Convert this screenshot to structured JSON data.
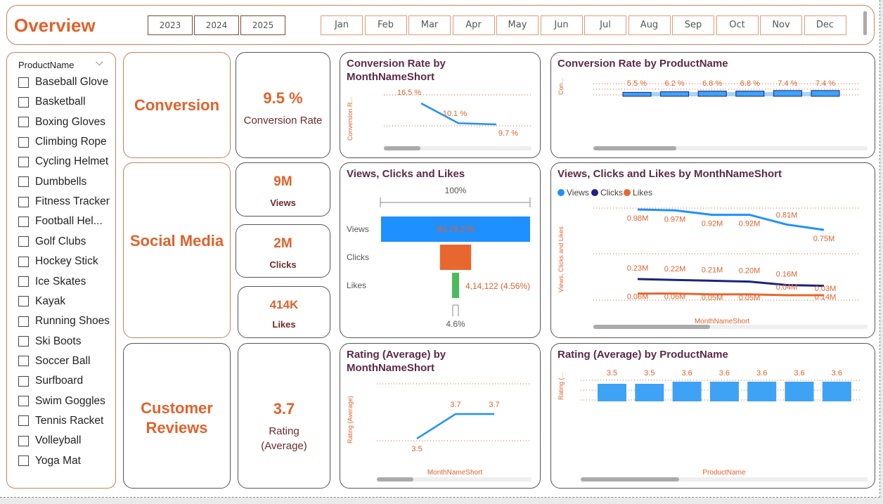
{
  "header": {
    "title": "Overview",
    "years": [
      "2023",
      "2024",
      "2025"
    ],
    "months": [
      "Jan",
      "Feb",
      "Mar",
      "Apr",
      "May",
      "Jun",
      "Jul",
      "Aug",
      "Sep",
      "Oct",
      "Nov",
      "Dec"
    ]
  },
  "slicer": {
    "title": "ProductName",
    "items": [
      "Baseball Glove",
      "Basketball",
      "Boxing Gloves",
      "Climbing Rope",
      "Cycling Helmet",
      "Dumbbells",
      "Fitness Tracker",
      "Football Hel...",
      "Golf Clubs",
      "Hockey Stick",
      "Ice Skates",
      "Kayak",
      "Running Shoes",
      "Ski Boots",
      "Soccer Ball",
      "Surfboard",
      "Swim Goggles",
      "Tennis Racket",
      "Volleyball",
      "Yoga Mat"
    ]
  },
  "sections": {
    "conversion": "Conversion",
    "social": "Social Media",
    "reviews_line1": "Customer",
    "reviews_line2": "Reviews"
  },
  "kpis": {
    "conversion_value": "9.5 %",
    "conversion_label": "Conversion Rate",
    "views_value": "9M",
    "views_label": "Views",
    "clicks_value": "2M",
    "clicks_label": "Clicks",
    "likes_value": "414K",
    "likes_label": "Likes",
    "rating_value": "3.7",
    "rating_label_1": "Rating",
    "rating_label_2": "(Average)"
  },
  "colors": {
    "accent": "#e0622c",
    "views": "#1e90ff",
    "clicks": "#1a237e",
    "likes": "#e8672e",
    "bar_blue": "#3ea2f5",
    "funnel_clicks": "#e8672e",
    "funnel_likes": "#4cbb5c"
  },
  "chart_data": [
    {
      "id": "conv-month",
      "type": "line",
      "title_line1": "Conversion Rate by",
      "title_line2": "MonthNameShort",
      "ylabel": "Conversion R...",
      "labels": [
        "16.5 %",
        "10.1 %",
        "9.7 %"
      ],
      "values": [
        16.5,
        10.1,
        9.7
      ]
    },
    {
      "id": "conv-product",
      "type": "bar",
      "title": "Conversion Rate by ProductName",
      "ylabel": "Con...",
      "labels": [
        "5.5 %",
        "6.2 %",
        "6.8 %",
        "6.8 %",
        "7.4 %",
        "7.4 %"
      ],
      "values": [
        5.5,
        6.2,
        6.8,
        6.8,
        7.4,
        7.4
      ]
    },
    {
      "id": "funnel",
      "type": "bar",
      "title": "Views, Clicks and Likes",
      "top_label": "100%",
      "bottom_label": "4.6%",
      "categories": [
        "Views",
        "Clicks",
        "Likes"
      ],
      "values": [
        9079276,
        1900000,
        414122
      ],
      "views_label": "90,79,276",
      "likes_label": "4,14,122 (4.56%)"
    },
    {
      "id": "vcl-month",
      "type": "line",
      "title": "Views, Clicks and Likes by MonthNameShort",
      "xlabel": "MonthNameShort",
      "ylabel": "Views, Clicks and Likes",
      "legend": [
        "Views",
        "Clicks",
        "Likes"
      ],
      "series": [
        {
          "name": "Views",
          "values": [
            0.98,
            0.97,
            0.92,
            0.92,
            0.81,
            0.75
          ],
          "labels": [
            "0.98M",
            "0.97M",
            "0.92M",
            "0.92M",
            "0.81M",
            "0.75M"
          ]
        },
        {
          "name": "Clicks",
          "values": [
            0.23,
            0.22,
            0.21,
            0.2,
            0.16,
            0.15
          ],
          "labels": [
            "0.23M",
            "0.22M",
            "0.21M",
            "0.20M",
            "0.16M",
            "0.15M"
          ]
        },
        {
          "name": "Likes",
          "values": [
            0.06,
            0.06,
            0.05,
            0.05,
            0.04,
            0.04
          ],
          "labels": [
            "0.06M",
            "0.06M",
            "0.05M",
            "0.05M",
            "0.04M",
            "0.04M"
          ]
        }
      ],
      "extra_labels": [
        "0.03M",
        "0.14M"
      ]
    },
    {
      "id": "rating-month",
      "type": "line",
      "title_line1": "Rating (Average) by",
      "title_line2": "MonthNameShort",
      "xlabel": "MonthNameShort",
      "ylabel": "Rating (Average)",
      "labels": [
        "3.5",
        "3.7",
        "3.7"
      ],
      "values": [
        3.5,
        3.7,
        3.7
      ]
    },
    {
      "id": "rating-product",
      "type": "bar",
      "title": "Rating (Average) by ProductName",
      "xlabel": "ProductName",
      "ylabel": "Rating (...",
      "labels": [
        "3.5",
        "3.5",
        "3.6",
        "3.6",
        "3.6",
        "3.6",
        "3.6"
      ],
      "values": [
        3.5,
        3.5,
        3.6,
        3.6,
        3.6,
        3.6,
        3.6
      ]
    }
  ]
}
